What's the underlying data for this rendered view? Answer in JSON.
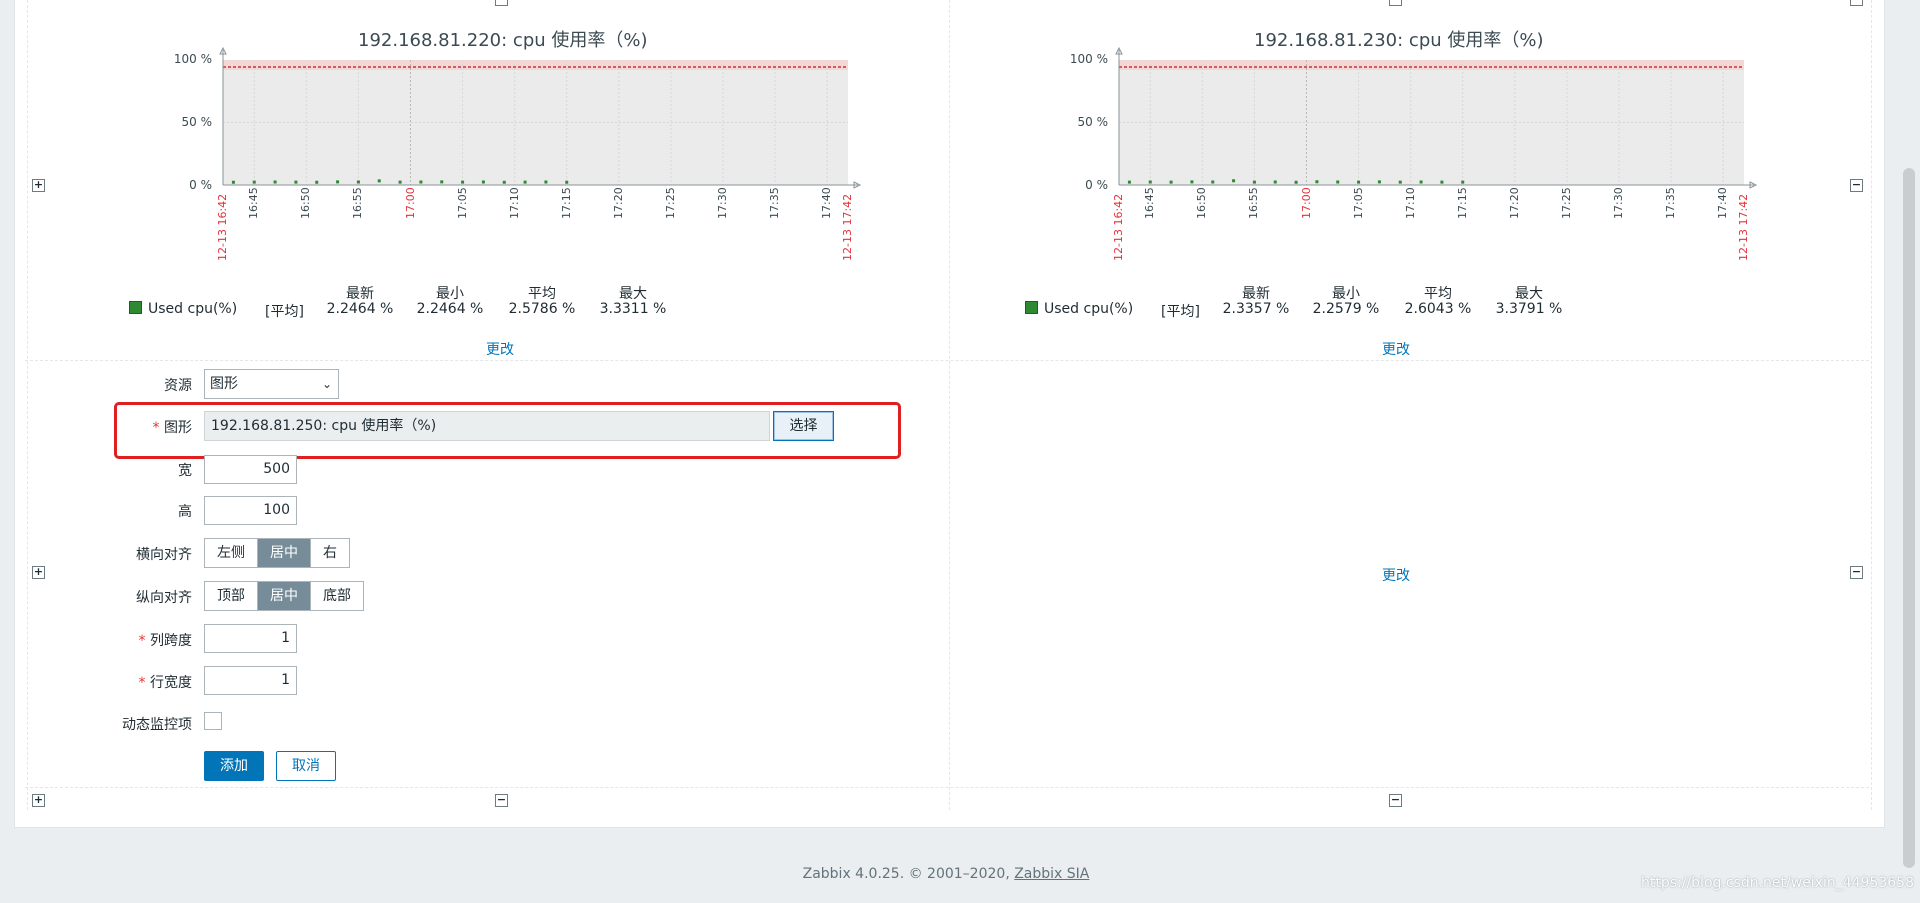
{
  "graphs": [
    {
      "title": "192.168.81.220: cpu 使用率（%)",
      "y_ticks": [
        "100 %",
        "50 %",
        "0 %"
      ],
      "x_ticks": [
        "16:45",
        "16:50",
        "16:55",
        "17:00",
        "17:05",
        "17:10",
        "17:15",
        "17:20",
        "17:25",
        "17:30",
        "17:35",
        "17:40"
      ],
      "x_start": "12-13 16:42",
      "x_end": "12-13 17:42",
      "legend_item": "Used cpu(%)",
      "legend_func": "[平均]",
      "headers": [
        "最新",
        "最小",
        "平均",
        "最大"
      ],
      "values": [
        "2.2464 %",
        "2.2464 %",
        "2.5786 %",
        "3.3311 %"
      ],
      "edit_link": "更改"
    },
    {
      "title": "192.168.81.230: cpu 使用率（%)",
      "y_ticks": [
        "100 %",
        "50 %",
        "0 %"
      ],
      "x_ticks": [
        "16:45",
        "16:50",
        "16:55",
        "17:00",
        "17:05",
        "17:10",
        "17:15",
        "17:20",
        "17:25",
        "17:30",
        "17:35",
        "17:40"
      ],
      "x_start": "12-13 16:42",
      "x_end": "12-13 17:42",
      "legend_item": "Used cpu(%)",
      "legend_func": "[平均]",
      "headers": [
        "最新",
        "最小",
        "平均",
        "最大"
      ],
      "values": [
        "2.3357 %",
        "2.2579 %",
        "2.6043 %",
        "3.3791 %"
      ],
      "edit_link": "更改"
    }
  ],
  "chart_data": [
    {
      "type": "line",
      "title": "192.168.81.220: cpu 使用率（%)",
      "ylim": [
        0,
        100
      ],
      "x_range": [
        "12-13 16:42",
        "12-13 17:42"
      ],
      "series": [
        {
          "name": "Used cpu(%)",
          "color": "#2d8a33",
          "x": [
            "16:43",
            "16:45",
            "16:47",
            "16:49",
            "16:51",
            "16:53",
            "16:55",
            "16:57",
            "16:59",
            "17:01",
            "17:03",
            "17:05",
            "17:07",
            "17:09",
            "17:11",
            "17:13",
            "17:15"
          ],
          "values": [
            2.2,
            2.3,
            2.4,
            2.3,
            2.2,
            2.5,
            2.4,
            3.3,
            2.3,
            2.4,
            2.5,
            2.3,
            2.4,
            2.2,
            2.3,
            2.4,
            2.2
          ]
        }
      ]
    },
    {
      "type": "line",
      "title": "192.168.81.230: cpu 使用率（%)",
      "ylim": [
        0,
        100
      ],
      "x_range": [
        "12-13 16:42",
        "12-13 17:42"
      ],
      "series": [
        {
          "name": "Used cpu(%)",
          "color": "#2d8a33",
          "x": [
            "16:43",
            "16:45",
            "16:47",
            "16:49",
            "16:51",
            "16:53",
            "16:55",
            "16:57",
            "16:59",
            "17:01",
            "17:03",
            "17:05",
            "17:07",
            "17:09",
            "17:11",
            "17:13",
            "17:15"
          ],
          "values": [
            2.3,
            2.4,
            2.3,
            2.5,
            2.4,
            3.4,
            2.3,
            2.4,
            2.2,
            2.6,
            2.4,
            2.3,
            2.5,
            2.3,
            2.4,
            2.3,
            2.3
          ]
        }
      ]
    }
  ],
  "form": {
    "resource_label": "资源",
    "resource_value": "图形",
    "graph_label": "图形",
    "graph_value": "192.168.81.250: cpu 使用率（%)",
    "select_button": "选择",
    "width_label": "宽",
    "width_value": "500",
    "height_label": "高",
    "height_value": "100",
    "halign_label": "横向对齐",
    "halign_options": [
      "左侧",
      "居中",
      "右"
    ],
    "valign_label": "纵向对齐",
    "valign_options": [
      "顶部",
      "居中",
      "底部"
    ],
    "colspan_label": "列跨度",
    "colspan_value": "1",
    "rowspan_label": "行宽度",
    "rowspan_value": "1",
    "dynamic_label": "动态监控项",
    "add_button": "添加",
    "cancel_button": "取消"
  },
  "empty_cell_link": "更改",
  "footer": {
    "text": "Zabbix 4.0.25. © 2001–2020,",
    "link": "Zabbix SIA"
  },
  "watermark": "https://blog.csdn.net/weixin_44953658"
}
